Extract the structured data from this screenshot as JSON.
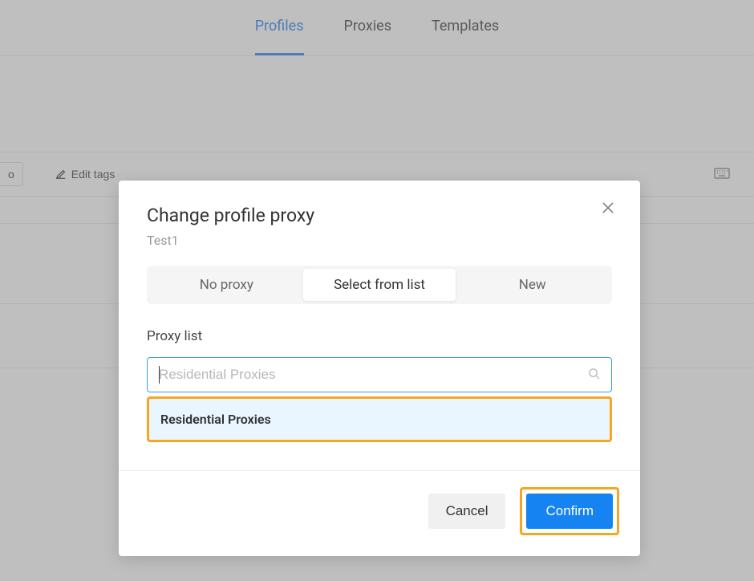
{
  "tabs": {
    "profiles": "Profiles",
    "proxies": "Proxies",
    "templates": "Templates"
  },
  "toolbar": {
    "truncated_btn": "o",
    "edit_tags": "Edit tags"
  },
  "modal": {
    "title": "Change profile proxy",
    "subtitle": "Test1",
    "segments": {
      "no_proxy": "No proxy",
      "select_from_list": "Select from list",
      "new_proxy": "New"
    },
    "proxy_list_label": "Proxy list",
    "search_placeholder": "Residential Proxies",
    "dropdown_option": "Residential Proxies",
    "cancel": "Cancel",
    "confirm": "Confirm"
  }
}
